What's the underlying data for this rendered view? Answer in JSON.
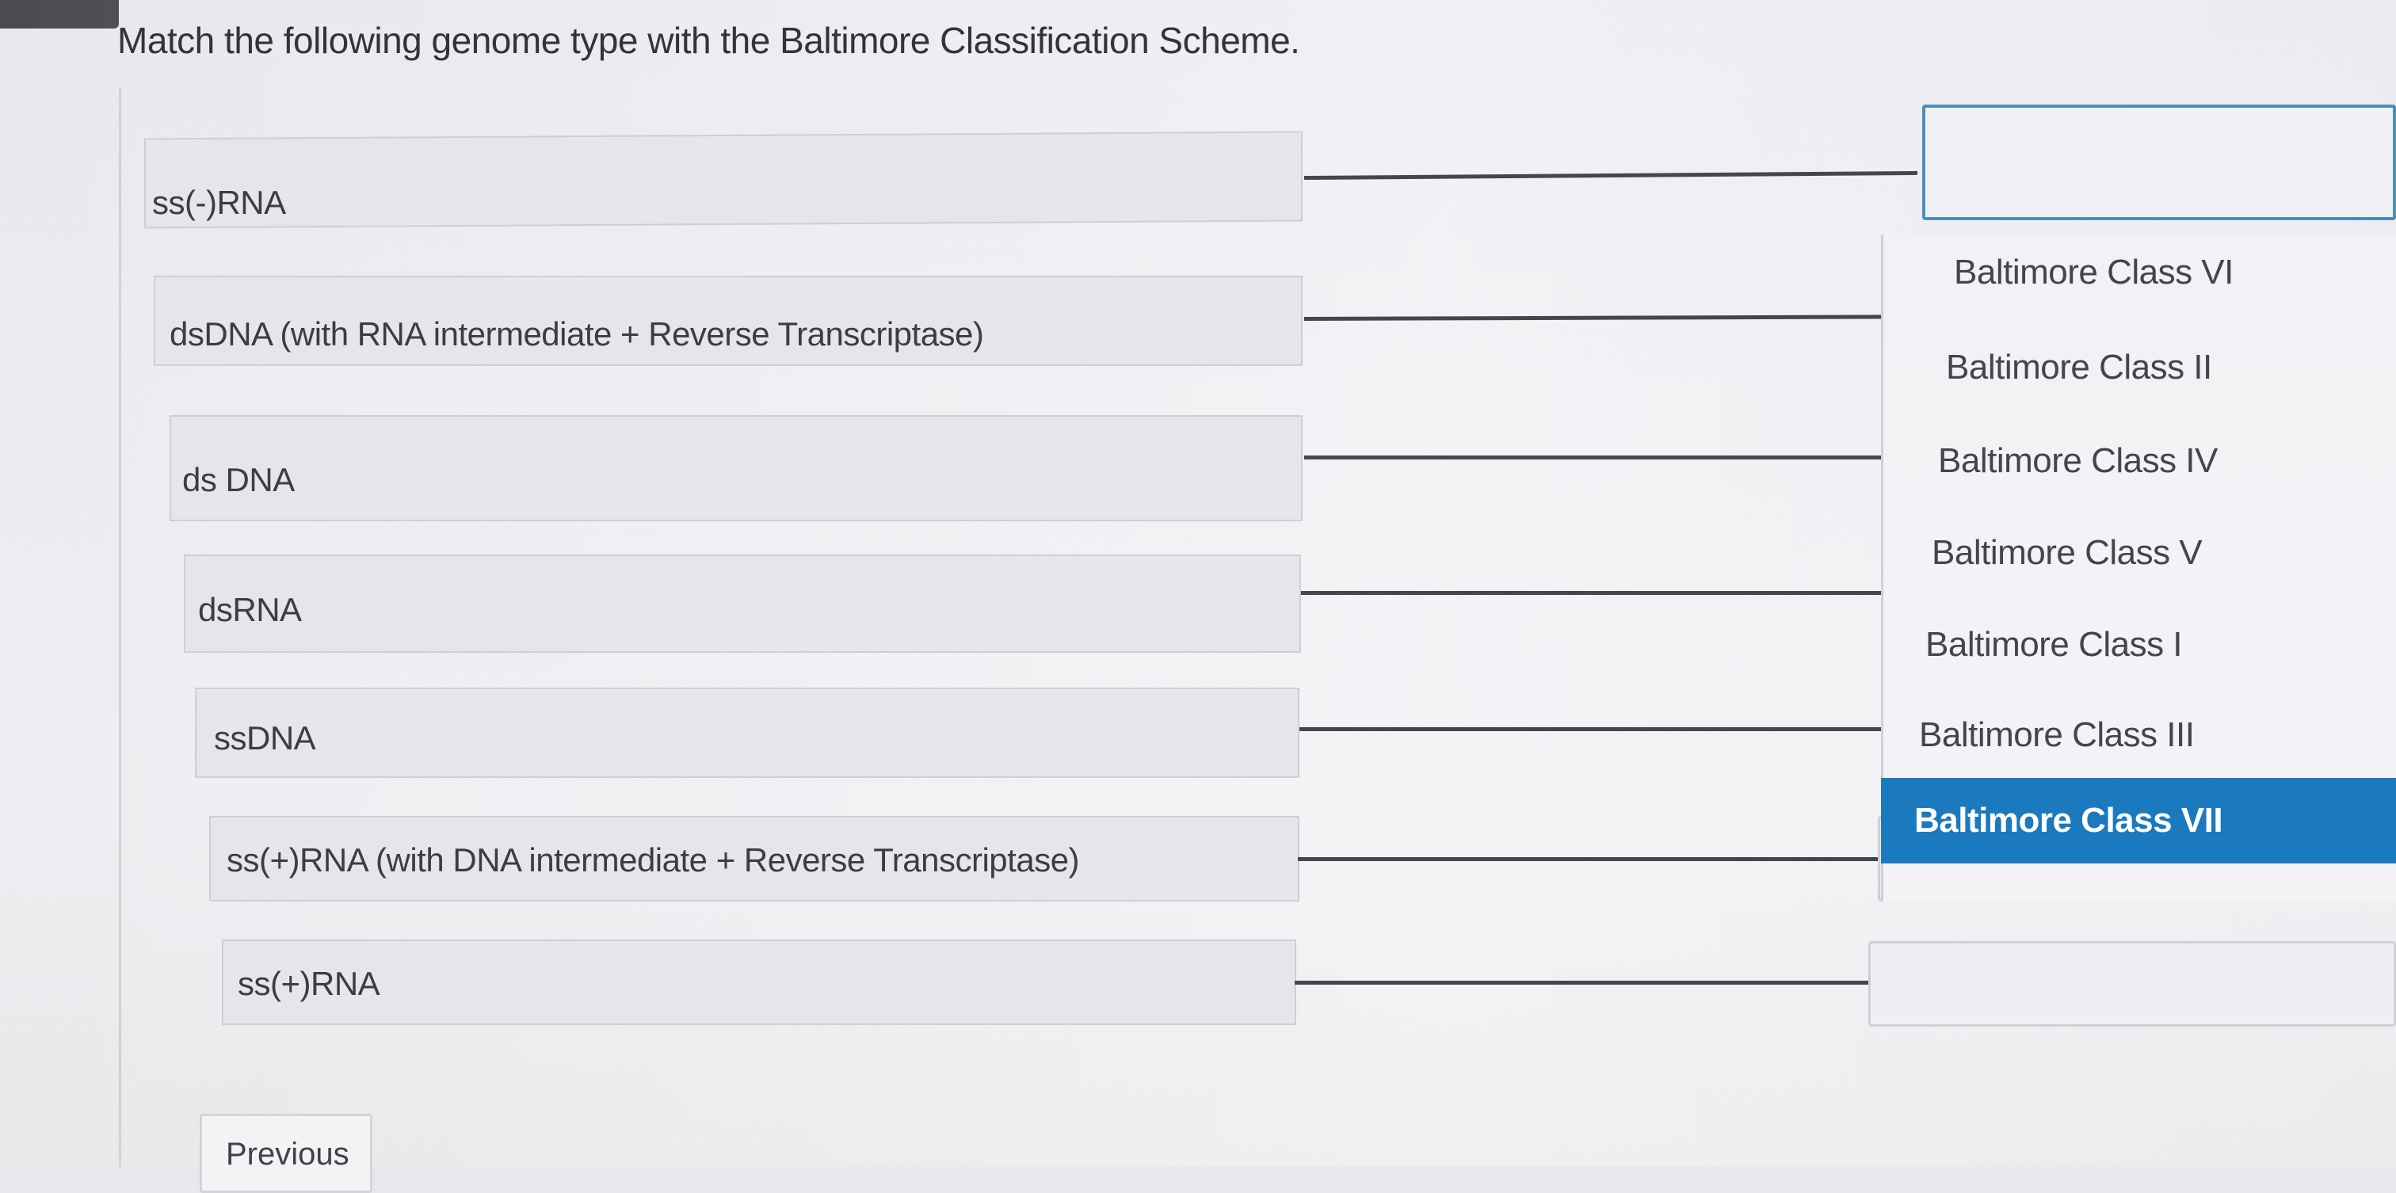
{
  "instruction": "Match the following genome type with the Baltimore Classification Scheme.",
  "prompts": [
    "ss(-)RNA",
    "dsDNA (with RNA intermediate + Reverse Transcriptase)",
    "ds DNA",
    "dsRNA",
    "ssDNA",
    "ss(+)RNA (with DNA intermediate + Reverse Transcriptase)",
    "ss(+)RNA"
  ],
  "options": [
    "Baltimore Class VI",
    "Baltimore Class II",
    "Baltimore Class IV",
    "Baltimore Class V",
    "Baltimore Class I",
    "Baltimore Class III",
    "Baltimore Class VII"
  ],
  "selected_option": "Baltimore Class VII",
  "navigation": {
    "previous_label": "Previous"
  },
  "colors": {
    "selected_background": "#1b79bd",
    "active_target_border": "#4a8fb6",
    "connector": "#44464f"
  }
}
